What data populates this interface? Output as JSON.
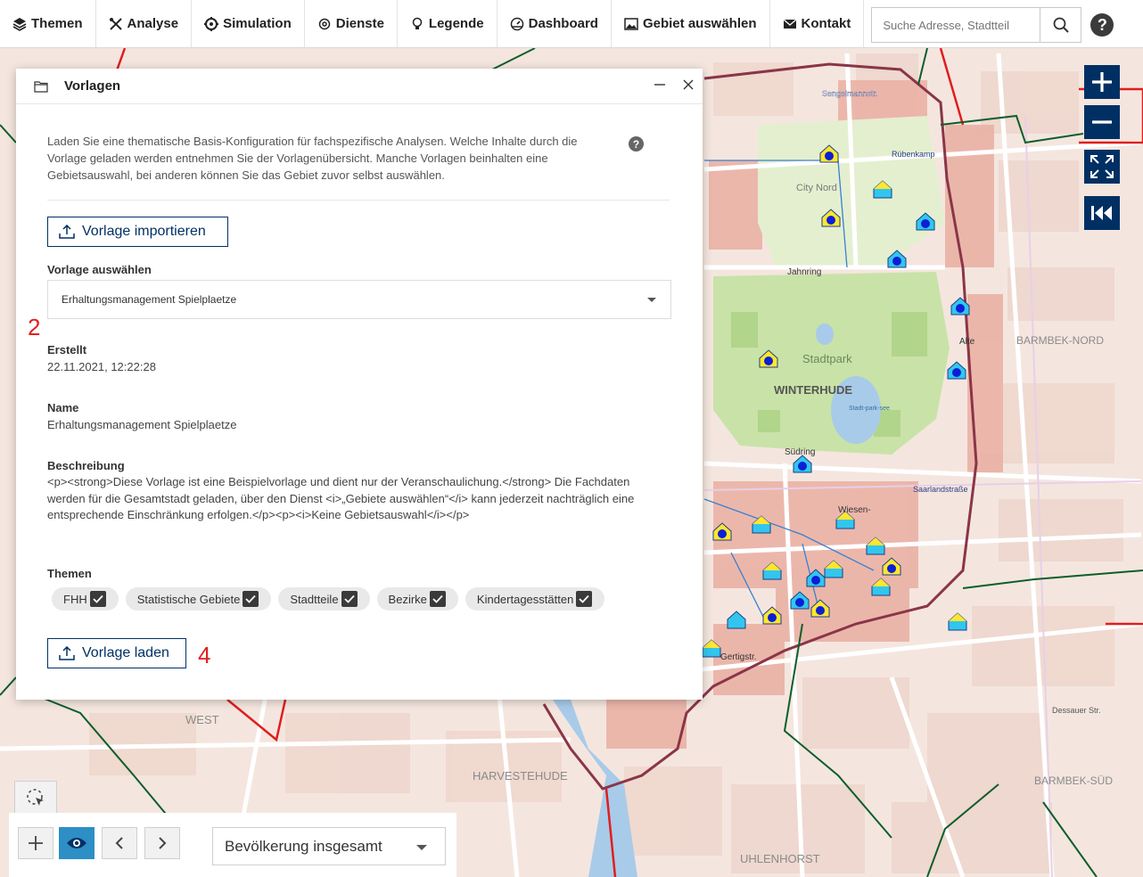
{
  "menu": {
    "items": [
      {
        "label": "Themen",
        "icon": "layers-icon"
      },
      {
        "label": "Analyse",
        "icon": "tools-icon"
      },
      {
        "label": "Simulation",
        "icon": "gear-icon"
      },
      {
        "label": "Dienste",
        "icon": "cog-icon"
      },
      {
        "label": "Legende",
        "icon": "lightbulb-icon"
      },
      {
        "label": "Dashboard",
        "icon": "dashboard-icon"
      },
      {
        "label": "Gebiet auswählen",
        "icon": "image-icon"
      },
      {
        "label": "Kontakt",
        "icon": "envelope-icon"
      }
    ],
    "search_placeholder": "Suche Adresse, Stadtteil",
    "help_label": "?"
  },
  "map": {
    "labels": [
      {
        "text": "Sengelmannstr."
      },
      {
        "text": "Rübenkamp"
      },
      {
        "text": "City Nord"
      },
      {
        "text": "Jahnring"
      },
      {
        "text": "Stadtpark"
      },
      {
        "text": "WINTERHUDE"
      },
      {
        "text": "BARMBEK-NORD"
      },
      {
        "text": "Südring"
      },
      {
        "text": "Saarlandstraße"
      },
      {
        "text": "Wiesen-"
      },
      {
        "text": "Gertigstr."
      },
      {
        "text": "WEST"
      },
      {
        "text": "HARVESTEHUDE"
      },
      {
        "text": "BARMBEK-SÜD"
      },
      {
        "text": "UHLENHORST"
      },
      {
        "text": "Dessauer Str."
      },
      {
        "text": "Alte"
      },
      {
        "text": "Stadt-park-see"
      }
    ]
  },
  "dialog": {
    "title": "Vorlagen",
    "intro": "Laden Sie eine thematische Basis-Konfiguration für fachspezifische Analysen. Welche Inhalte durch die Vorlage geladen werden entnehmen Sie der Vorlagenübersicht. Manche Vorlagen beinhalten eine Gebietsauswahl, bei anderen können Sie das Gebiet zuvor selbst auswählen.",
    "import_label": "Vorlage importieren",
    "select_label": "Vorlage auswählen",
    "select_value": "Erhaltungsmanagement Spielplaetze",
    "created_label": "Erstellt",
    "created_value": "22.11.2021, 12:22:28",
    "name_label": "Name",
    "name_value": "Erhaltungsmanagement Spielplaetze",
    "desc_label": "Beschreibung",
    "desc_value": "<p><strong>Diese Vorlage ist eine Beispielvorlage und dient nur der Veranschaulichung.</strong> Die Fachdaten werden für die Gesamtstadt geladen, über den Dienst <i>„Gebiete auswählen“</i> kann jederzeit nachträglich eine entsprechende Einschränkung erfolgen.</p><p><i>Keine Gebietsauswahl</i></p>",
    "themes_label": "Themen",
    "themes": [
      "FHH",
      "Statistische Gebiete",
      "Stadtteile",
      "Bezirke",
      "Kindertagesstätten"
    ],
    "load_label": "Vorlage laden",
    "annotation_2": "2",
    "annotation_4": "4"
  },
  "bottom": {
    "layer_select_value": "Bevölkerung insgesamt"
  },
  "colors": {
    "accent": "#003063",
    "highlight_blue": "#2e8ec6",
    "annotation_red": "#e02020"
  }
}
